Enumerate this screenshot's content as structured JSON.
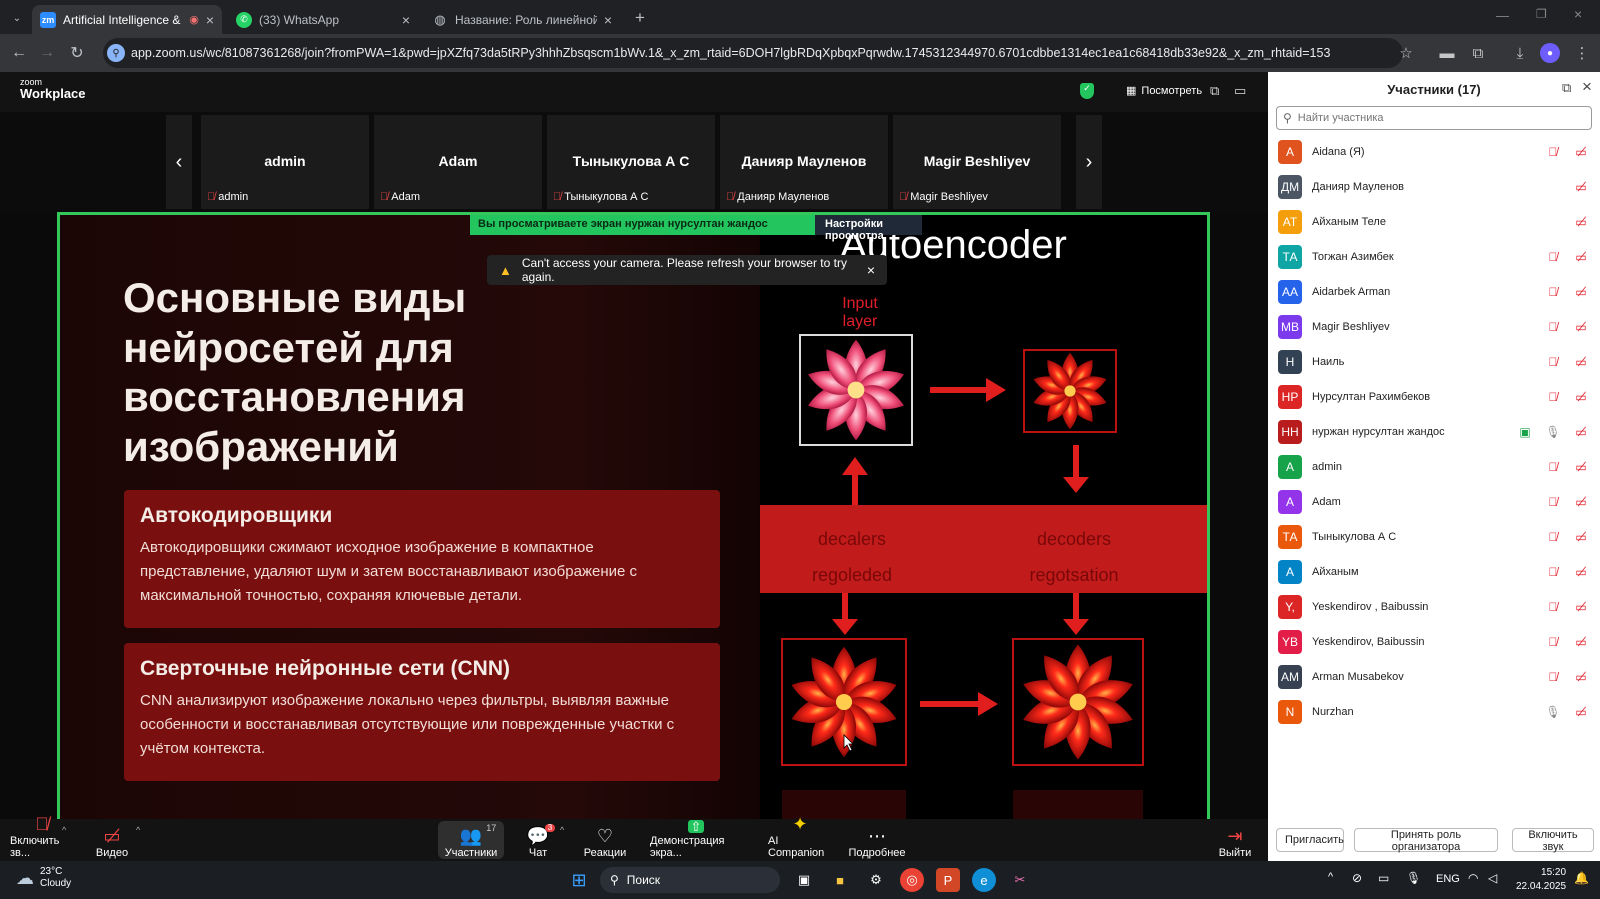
{
  "browser": {
    "tabs": [
      {
        "label": "Artificial Intelligence & App",
        "icon": "zoom-favicon-icon",
        "active": true
      },
      {
        "label": "(33) WhatsApp",
        "icon": "whatsapp-icon",
        "active": false
      },
      {
        "label": "Название: Роль линейной ал",
        "icon": "globe-icon",
        "active": false
      }
    ],
    "url": "app.zoom.us/wc/81087361268/join?fromPWA=1&pwd=jpXZfq73da5tRPy3hhhZbsqscm1bWv.1&_x_zm_rtaid=6DOH7lgbRDqXpbqxPqrwdw.1745312344970.6701cdbbe1314ec1ea1c68418db33e92&_x_zm_rhtaid=153"
  },
  "zoom": {
    "logo_top": "zoom",
    "logo_bottom": "Workplace",
    "view_label": "Посмотреть",
    "strip": [
      {
        "name": "admin",
        "label": "admin"
      },
      {
        "name": "Adam",
        "label": "Adam"
      },
      {
        "name": "Тыныкулова А С",
        "label": "Тыныкулова А С"
      },
      {
        "name": "Данияр Мауленов",
        "label": "Данияр Мауленов"
      },
      {
        "name": "Magir Beshliyev",
        "label": "Magir Beshliyev"
      }
    ],
    "banner_viewing": "Вы просматриваете экран  нуржан нурсултан жандос",
    "banner_settings": "Настройки просмотра",
    "toast": "Can't access your camera. Please refresh your browser to try again."
  },
  "slide": {
    "title_lines": [
      "Основные виды",
      "нейросетей для",
      "восстановления",
      "изображений"
    ],
    "cards": [
      {
        "heading": "Автокодировщики",
        "text": "Автокодировщики сжимают исходное изображение в компактное представление, удаляют шум и затем восстанавливают изображение с максимальной точностью, сохраняя ключевые детали."
      },
      {
        "heading": "Сверточные нейронные сети (CNN)",
        "text": "CNN анализируют изображение локально через фильтры, выявляя важные особенности и восстанавливая отсутствующие или поврежденные участки с учётом контекста."
      }
    ],
    "diagram_title": "Autoencoder",
    "input_label_1": "Input",
    "input_label_2": "layer",
    "band_left_1": "decalers",
    "band_left_2": "regoleded",
    "band_right_1": "decoders",
    "band_right_2": "regotsation"
  },
  "toolbar": {
    "items": [
      {
        "label": "Включить зв...",
        "icon": "mic-off-icon"
      },
      {
        "label": "Видео",
        "icon": "video-off-icon"
      },
      {
        "label": "Участники",
        "icon": "participants-icon",
        "count": "17"
      },
      {
        "label": "Чат",
        "icon": "chat-icon",
        "badge": "3"
      },
      {
        "label": "Реакции",
        "icon": "heart-icon"
      },
      {
        "label": "Демонстрация экра...",
        "icon": "share-screen-icon"
      },
      {
        "label": "AI Companion",
        "icon": "sparkle-icon"
      },
      {
        "label": "Подробнее",
        "icon": "more-icon"
      }
    ],
    "leave": "Выйти"
  },
  "panel": {
    "title": "Участники (17)",
    "search_placeholder": "Найти участника",
    "participants": [
      {
        "initials": "A",
        "name": "Aidana (Я)",
        "color": "#e0531f",
        "mic": "off",
        "video": "off"
      },
      {
        "initials": "ДМ",
        "name": "Данияр Мауленов",
        "color": "#4b5563",
        "mic": "none",
        "video": "off"
      },
      {
        "initials": "АТ",
        "name": "Айханым Теле",
        "color": "#f59e0b",
        "mic": "none",
        "video": "off"
      },
      {
        "initials": "ТА",
        "name": "Тогжан Азимбек",
        "color": "#0ea5a4",
        "mic": "off",
        "video": "off"
      },
      {
        "initials": "AA",
        "name": "Aidarbek Arman",
        "color": "#2563eb",
        "mic": "off",
        "video": "off"
      },
      {
        "initials": "MB",
        "name": "Magir Beshliyev",
        "color": "#7c3aed",
        "mic": "off",
        "video": "off"
      },
      {
        "initials": "Н",
        "name": "Наиль",
        "color": "#334155",
        "mic": "off",
        "video": "off"
      },
      {
        "initials": "НР",
        "name": "Нурсултан Рахимбеков",
        "color": "#dc2626",
        "mic": "off",
        "video": "off"
      },
      {
        "initials": "НН",
        "name": "нуржан нурсултан жандос",
        "color": "#b91c1c",
        "mic": "on",
        "video": "off",
        "sharing": true
      },
      {
        "initials": "A",
        "name": "admin",
        "color": "#16a34a",
        "mic": "off",
        "video": "off"
      },
      {
        "initials": "A",
        "name": "Adam",
        "color": "#9333ea",
        "mic": "off",
        "video": "off"
      },
      {
        "initials": "ТА",
        "name": "Тыныкулова А С",
        "color": "#ea580c",
        "mic": "off",
        "video": "off"
      },
      {
        "initials": "A",
        "name": "Айханым",
        "color": "#0284c7",
        "mic": "off",
        "video": "off"
      },
      {
        "initials": "Y,",
        "name": "Yeskendirov , Baibussin",
        "color": "#dc2626",
        "mic": "off",
        "video": "off"
      },
      {
        "initials": "YB",
        "name": "Yeskendirov, Baibussin",
        "color": "#e11d48",
        "mic": "off",
        "video": "off"
      },
      {
        "initials": "AM",
        "name": "Arman Musabekov",
        "color": "#374151",
        "mic": "off",
        "video": "off"
      },
      {
        "initials": "N",
        "name": "Nurzhan",
        "color": "#ea580c",
        "mic": "on",
        "video": "off"
      }
    ],
    "btn_invite": "Пригласить",
    "btn_host": "Принять роль организатора",
    "btn_audio": "Включить звук"
  },
  "taskbar": {
    "weather_temp": "23°C",
    "weather_desc": "Cloudy",
    "search_label": "Поиск",
    "lang": "ENG",
    "time": "15:20",
    "date": "22.04.2025"
  }
}
